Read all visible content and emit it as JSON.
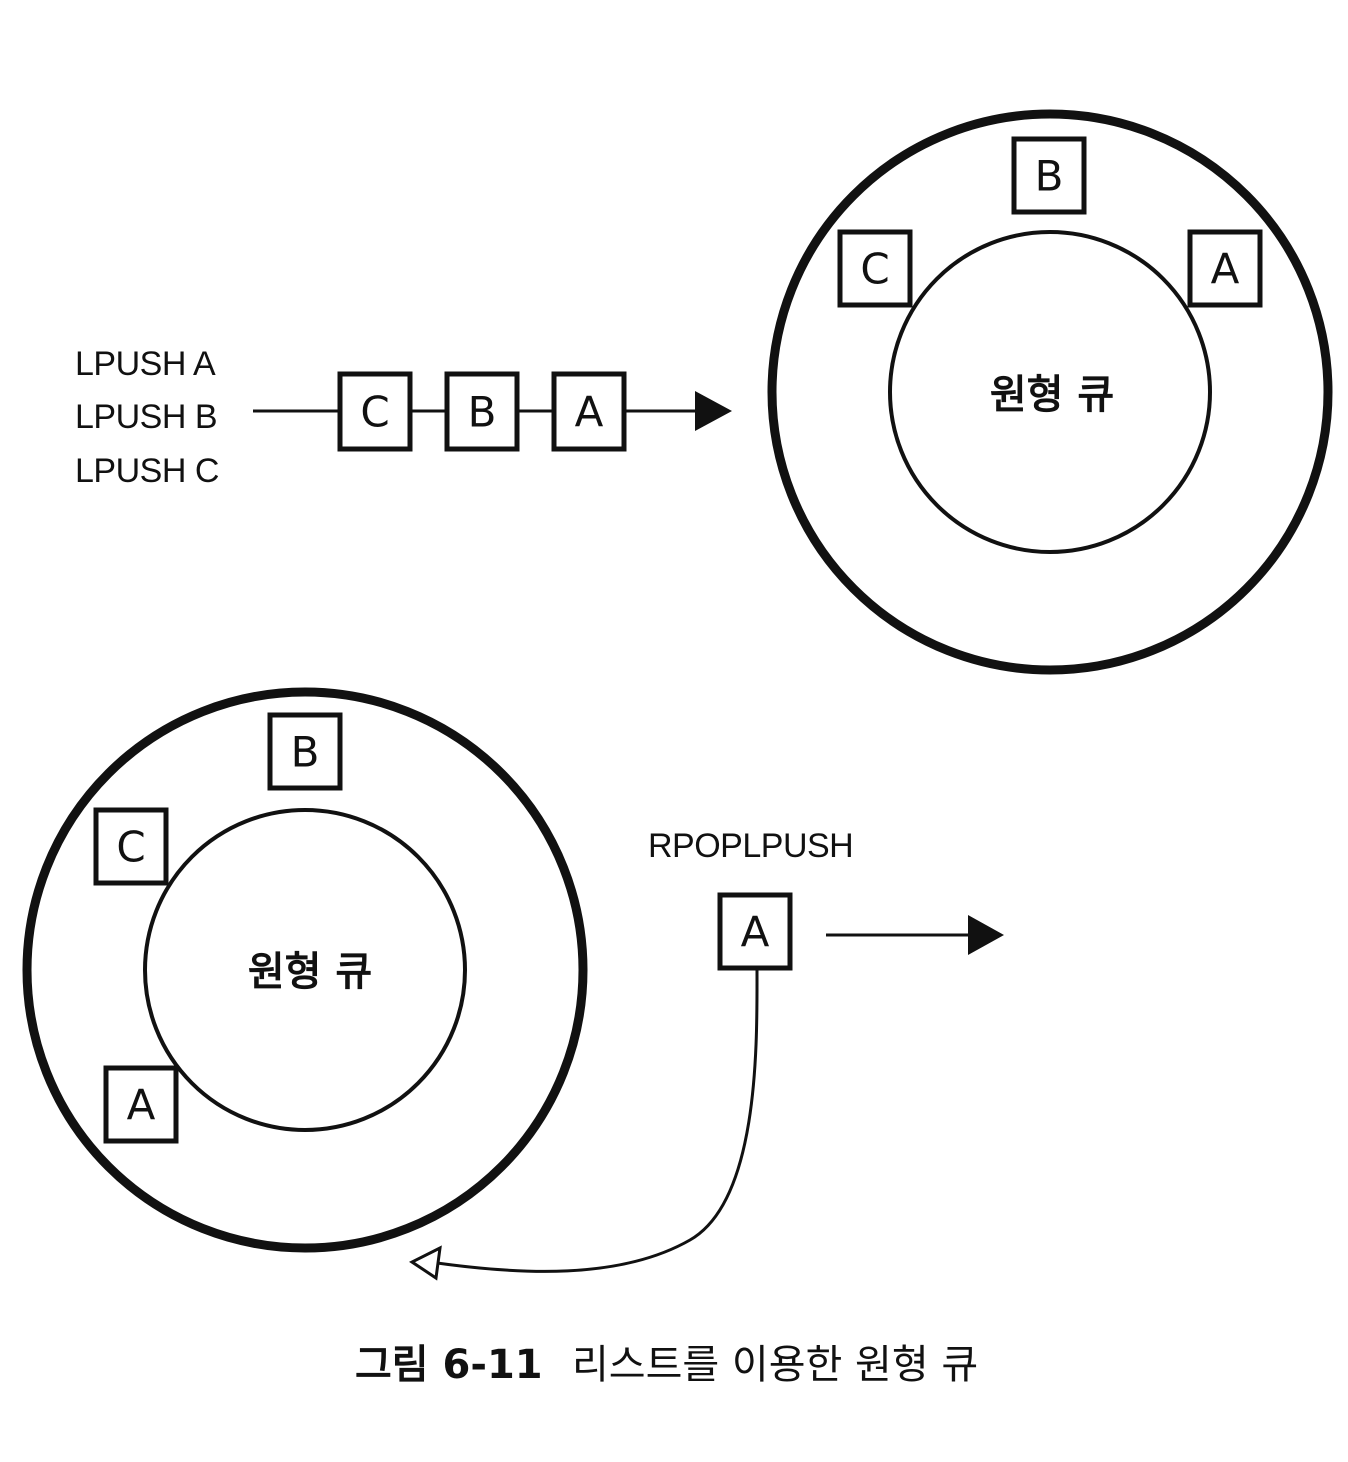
{
  "top": {
    "commands": [
      "LPUSH A",
      "LPUSH B",
      "LPUSH C"
    ],
    "list_boxes": [
      "C",
      "B",
      "A"
    ],
    "queue_label": "원형 큐",
    "ring_boxes": {
      "top": "B",
      "left": "C",
      "right": "A"
    }
  },
  "bottom": {
    "queue_label": "원형 큐",
    "ring_boxes": {
      "top": "B",
      "left": "C",
      "bottom_left": "A"
    },
    "command": "RPOPLPUSH",
    "popped_box": "A"
  },
  "caption": {
    "number": "그림 6-11",
    "title": "리스트를 이용한 원형 큐"
  }
}
